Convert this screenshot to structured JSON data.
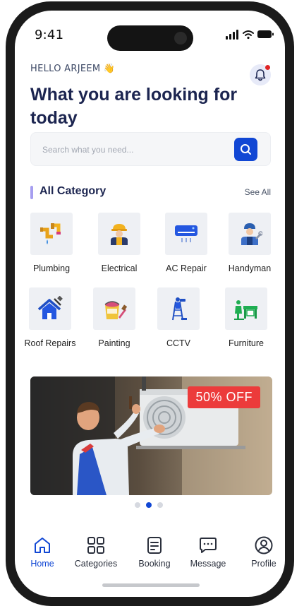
{
  "status_bar": {
    "time": "9:41",
    "icons": [
      "signal-icon",
      "wifi-icon",
      "battery-icon"
    ]
  },
  "header": {
    "greeting": "HELLO ARJEEM",
    "greeting_emoji": "👋",
    "headline": "What you are looking for today",
    "notification_icon": "bell-icon",
    "has_unread_notifications": true
  },
  "search": {
    "placeholder": "Search what you need...",
    "value": "",
    "button_icon": "search-icon"
  },
  "categories": {
    "title": "All Category",
    "see_all_label": "See All",
    "items": [
      {
        "label": "Plumbing",
        "icon": "plumbing-pipes-icon"
      },
      {
        "label": "Electrical",
        "icon": "electrician-icon"
      },
      {
        "label": "AC Repair",
        "icon": "air-conditioner-icon"
      },
      {
        "label": "Handyman",
        "icon": "handyman-icon"
      },
      {
        "label": "Roof Repairs",
        "icon": "roof-repair-icon"
      },
      {
        "label": "Painting",
        "icon": "paint-bucket-icon"
      },
      {
        "label": "CCTV",
        "icon": "cctv-technician-icon"
      },
      {
        "label": "Furniture",
        "icon": "furniture-icon"
      }
    ]
  },
  "promo": {
    "badge": "50% OFF",
    "image_description_icon": "ac-repair-technician-photo",
    "slides": 3,
    "active_slide": 2
  },
  "bottom_nav": {
    "items": [
      {
        "label": "Home",
        "icon": "home-icon",
        "active": true
      },
      {
        "label": "Categories",
        "icon": "grid-icon",
        "active": false
      },
      {
        "label": "Booking",
        "icon": "document-icon",
        "active": false
      },
      {
        "label": "Message",
        "icon": "message-icon",
        "active": false
      },
      {
        "label": "Profile",
        "icon": "user-icon",
        "active": false
      }
    ]
  },
  "colors": {
    "primary": "#1147d4",
    "heading": "#1c2550",
    "badge": "#ec3b3b",
    "accent_bar": "#a69ef0",
    "tile_bg": "#eef0f4"
  }
}
